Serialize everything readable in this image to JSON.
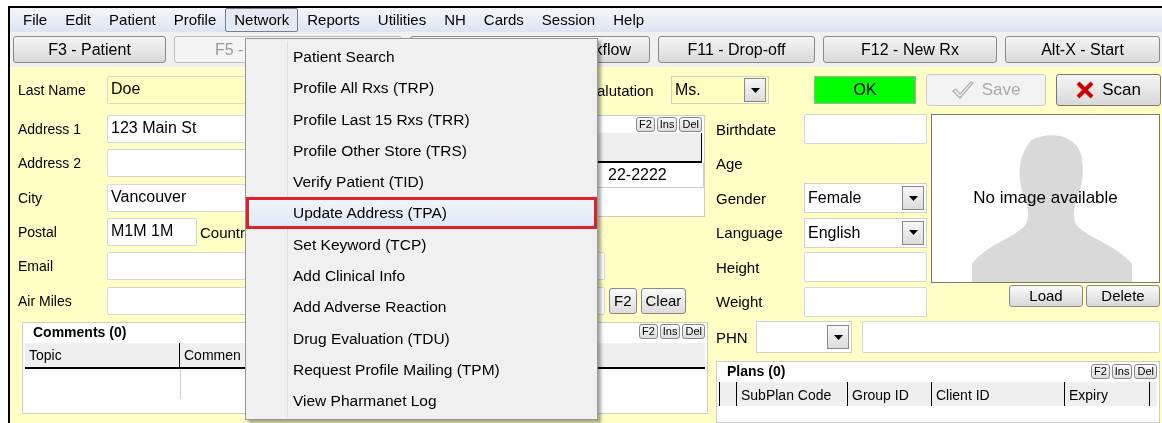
{
  "menu_bar": [
    {
      "label": "File",
      "selected": false
    },
    {
      "label": "Edit",
      "selected": false
    },
    {
      "label": "Patient",
      "selected": false
    },
    {
      "label": "Profile",
      "selected": false
    },
    {
      "label": "Network",
      "selected": true
    },
    {
      "label": "Reports",
      "selected": false
    },
    {
      "label": "Utilities",
      "selected": false
    },
    {
      "label": "NH",
      "selected": false
    },
    {
      "label": "Cards",
      "selected": false
    },
    {
      "label": "Session",
      "selected": false
    },
    {
      "label": "Help",
      "selected": false
    }
  ],
  "toolbar": [
    {
      "label": "F3 - Patient",
      "disabled": false
    },
    {
      "label": "F5 -",
      "disabled": true
    },
    {
      "label": "kflow",
      "disabled": false
    },
    {
      "label": "F11 - Drop-off",
      "disabled": false
    },
    {
      "label": "F12 - New Rx",
      "disabled": false
    },
    {
      "label": "Alt-X - Start",
      "disabled": false
    }
  ],
  "header_row": {
    "last_name": {
      "label": "Last Name",
      "value": "Doe"
    },
    "salutation": {
      "label": "alutation",
      "value": "Ms."
    },
    "status": "OK",
    "buttons": [
      {
        "label": "Save",
        "disabled": true
      },
      {
        "label": "Scan",
        "disabled": false
      }
    ]
  },
  "address_fields": [
    {
      "label": "Address 1",
      "value": "123 Main St"
    },
    {
      "label": "Address 2"
    },
    {
      "label": "City",
      "value": "Vancouver"
    },
    {
      "label": "Postal",
      "value": "M1M 1M",
      "extra_label": "Countr"
    }
  ],
  "phones": {
    "buttons": [
      "F2",
      "Ins",
      "Del"
    ],
    "cell": "22-2222"
  },
  "email": {
    "label": "Email"
  },
  "air_miles": {
    "label": "Air Miles",
    "buttons": [
      "F2",
      "Clear"
    ]
  },
  "comments": {
    "title": "Comments (0)",
    "buttons": [
      "F2",
      "Ins",
      "Del"
    ],
    "columns": [
      "Topic",
      "Commen"
    ]
  },
  "details": [
    {
      "label": "Birthdate",
      "kind": "text"
    },
    {
      "label": "Age",
      "kind": "none"
    },
    {
      "label": "Gender",
      "kind": "select",
      "value": "Female"
    },
    {
      "label": "Language",
      "kind": "select",
      "value": "English"
    },
    {
      "label": "Height",
      "kind": "text"
    },
    {
      "label": "Weight",
      "kind": "text"
    }
  ],
  "photo": {
    "caption": "No image available",
    "buttons": [
      "Load",
      "Delete"
    ]
  },
  "phn": {
    "label": "PHN"
  },
  "plans": {
    "title": "Plans (0)",
    "buttons": [
      "F2",
      "Ins",
      "Del"
    ],
    "columns": [
      "SubPlan Code",
      "Group ID",
      "Client ID",
      "Expiry"
    ]
  },
  "network_menu": [
    {
      "label": "Patient Search",
      "selected": false
    },
    {
      "label": "Profile All Rxs (TRP)",
      "selected": false
    },
    {
      "label": "Profile Last 15 Rxs (TRR)",
      "selected": false
    },
    {
      "label": "Profile Other Store (TRS)",
      "selected": false
    },
    {
      "label": "Verify Patient (TID)",
      "selected": false
    },
    {
      "label": "Update Address (TPA)",
      "selected": true
    },
    {
      "label": "Set Keyword (TCP)",
      "selected": false
    },
    {
      "label": "Add Clinical Info",
      "selected": false
    },
    {
      "label": "Add Adverse Reaction",
      "selected": false
    },
    {
      "label": "Drug Evaluation (TDU)",
      "selected": false
    },
    {
      "label": "Request Profile Mailing (TPM)",
      "selected": false
    },
    {
      "label": "View Pharmanet Log",
      "selected": false
    }
  ]
}
